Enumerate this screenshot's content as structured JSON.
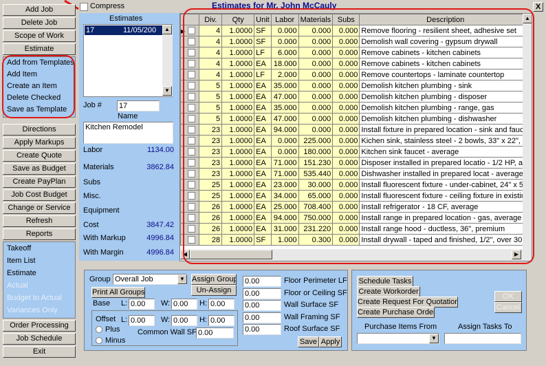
{
  "window_title": "Estimates for Mr. John McCauly",
  "close_glyph": "X",
  "compress_label": "Compress",
  "sidebar": {
    "top_buttons": [
      "Add Job",
      "Delete Job",
      "Scope of Work",
      "Estimate"
    ],
    "estimate_links": [
      "Add from Templates",
      "Add Item",
      "Create an Item",
      "Delete Checked",
      "Save as Template"
    ],
    "mid_buttons": [
      "Directions",
      "Apply Markups",
      "Create Quote",
      "Save as Budget",
      "Create PayPlan",
      "Job Cost Budget",
      "Change or Service",
      "Refresh",
      "Reports"
    ],
    "report_links": [
      {
        "label": "Takeoff",
        "enabled": true
      },
      {
        "label": "Item List",
        "enabled": true
      },
      {
        "label": "Estimate",
        "enabled": true
      },
      {
        "label": "Actual",
        "enabled": false
      },
      {
        "label": "Budget to Actual",
        "enabled": false
      },
      {
        "label": "Variances Only",
        "enabled": false
      }
    ],
    "bottom_buttons": [
      "Order Processing",
      "Job Schedule",
      "Exit"
    ]
  },
  "estimates_panel": {
    "heading": "Estimates",
    "list": [
      {
        "id": "17",
        "date": "11/05/200"
      }
    ],
    "job_label": "Job #",
    "job_value": "17",
    "name_label": "Name",
    "name_value": "Kitchen Remodel",
    "summary": [
      {
        "label": "Labor",
        "value": "1134.00"
      },
      {
        "label": "Materials",
        "value": "3862.84"
      },
      {
        "label": "Subs",
        "value": ""
      },
      {
        "label": "Misc.",
        "value": ""
      },
      {
        "label": "Equipment",
        "value": ""
      },
      {
        "label": "Cost",
        "value": "3847.42"
      },
      {
        "label": "With Markup",
        "value": "4996.84"
      },
      {
        "label": "With Margin",
        "value": "4996.84"
      }
    ]
  },
  "grid": {
    "columns": [
      "",
      "Div.",
      "Qty",
      "Unit",
      "Labor",
      "Materials",
      "Subs",
      "Description"
    ],
    "rows": [
      [
        "4",
        "1.0000",
        "SF",
        "0.000",
        "0.000",
        "0.000",
        "Remove flooring - resilient sheet, adhesive set"
      ],
      [
        "4",
        "1.0000",
        "SF",
        "0.000",
        "0.000",
        "0.000",
        "Demolish wall covering - gypsum drywall"
      ],
      [
        "4",
        "1.0000",
        "LF",
        "6.000",
        "0.000",
        "0.000",
        "Remove cabinets - kitchen cabinets"
      ],
      [
        "4",
        "1.0000",
        "EA",
        "18.000",
        "0.000",
        "0.000",
        "Remove cabinets - kitchen cabinets"
      ],
      [
        "4",
        "1.0000",
        "LF",
        "2.000",
        "0.000",
        "0.000",
        "Remove countertops - laminate countertop"
      ],
      [
        "5",
        "1.0000",
        "EA",
        "35.000",
        "0.000",
        "0.000",
        "Demolish kitchen plumbing - sink"
      ],
      [
        "5",
        "1.0000",
        "EA",
        "47.000",
        "0.000",
        "0.000",
        "Demolish kitchen plumbing - disposer"
      ],
      [
        "5",
        "1.0000",
        "EA",
        "35.000",
        "0.000",
        "0.000",
        "Demolish kitchen plumbing - range, gas"
      ],
      [
        "5",
        "1.0000",
        "EA",
        "47.000",
        "0.000",
        "0.000",
        "Demolish kitchen plumbing - dishwasher"
      ],
      [
        "23",
        "1.0000",
        "EA",
        "94.000",
        "0.000",
        "0.000",
        "Install fixture in prepared location - sink and fauce"
      ],
      [
        "23",
        "1.0000",
        "EA",
        "0.000",
        "225.000",
        "0.000",
        "Kichen sink, stainless steel - 2 bowls, 33\" x 22\","
      ],
      [
        "23",
        "1.0000",
        "EA",
        "0.000",
        "180.000",
        "0.000",
        "Kitchen sink faucet - average"
      ],
      [
        "23",
        "1.0000",
        "EA",
        "71.000",
        "151.230",
        "0.000",
        "Disposer installed in prepared locatio - 1/2 HP, a"
      ],
      [
        "23",
        "1.0000",
        "EA",
        "71.000",
        "535.440",
        "0.000",
        "Dishwasher installed in prepared locat - average"
      ],
      [
        "25",
        "1.0000",
        "EA",
        "23.000",
        "30.000",
        "0.000",
        "Install fluorescent fixture - under-cabinet, 24\" x 5"
      ],
      [
        "25",
        "1.0000",
        "EA",
        "34.000",
        "65.000",
        "0.000",
        "Install fluorescent fixture - ceiling fixture in existing"
      ],
      [
        "26",
        "1.0000",
        "EA",
        "25.000",
        "708.400",
        "0.000",
        "Install refrigerator - 18 CF, average"
      ],
      [
        "26",
        "1.0000",
        "EA",
        "94.000",
        "750.000",
        "0.000",
        "Install range in prepared location - gas, average"
      ],
      [
        "26",
        "1.0000",
        "EA",
        "31.000",
        "231.220",
        "0.000",
        "Install range hood - ductless, 36\", premium"
      ],
      [
        "28",
        "1.0000",
        "SF",
        "1.000",
        "0.300",
        "0.000",
        "Install drywall - taped and finished, 1/2\", over 30"
      ]
    ]
  },
  "group_panel": {
    "group_label": "Group",
    "group_value": "Overall Job",
    "assign_group": "Assign Group",
    "print_all_groups": "Print All Groups",
    "un_assign": "Un-Assign",
    "base_label": "Base",
    "l_label": "L:",
    "w_label": "W:",
    "h_label": "H:",
    "base_l": "0.00",
    "base_w": "0.00",
    "base_h": "0.00",
    "offset_label": "Offset",
    "off_l": "0.00",
    "off_w": "0.00",
    "off_h": "0.00",
    "plus_label": "Plus",
    "minus_label": "Minus",
    "common_wall_label": "Common Wall SF",
    "common_wall_value": "0.00",
    "measures": [
      {
        "label": "Floor Perimeter LF",
        "value": "0.00"
      },
      {
        "label": "Floor or Ceiling SF",
        "value": "0.00"
      },
      {
        "label": "Wall Surface SF",
        "value": "0.00"
      },
      {
        "label": "Wall Framing SF",
        "value": "0.00"
      },
      {
        "label": "Roof Surface SF",
        "value": "0.00"
      }
    ],
    "save": "Save",
    "apply": "Apply"
  },
  "task_panel": {
    "schedule_tasks": "Schedule Tasks",
    "create_workorder": "Create Workorder",
    "create_request_quotation": "Create Request For Quotation",
    "create_purchase_order": "Create Purchase Order",
    "ok": "OK",
    "cancel": "Cancel",
    "purchase_items_from": "Purchase Items From",
    "assign_tasks_to": "Assign Tasks To"
  },
  "colors": {
    "highlight": "#e01818",
    "panel_blue": "#a6caf0",
    "grid_yellow": "#ffffc0",
    "title_blue": "#0c0c8c"
  }
}
